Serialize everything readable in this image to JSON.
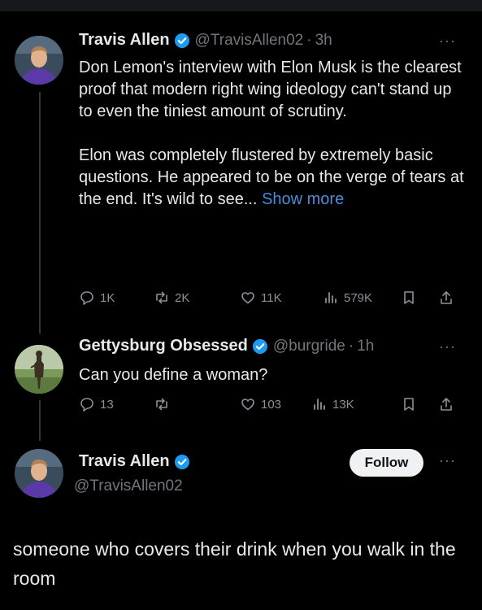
{
  "tweets": [
    {
      "name": "Travis Allen",
      "handle": "@TravisAllen02",
      "sep": "·",
      "time": "3h",
      "more": "···",
      "paragraphs": [
        "Don Lemon's interview with Elon Musk is the clearest proof that modern right wing ideology can't stand up to even the tiniest amount of scrutiny.",
        "Elon was completely flustered by extremely basic questions. He appeared to be on the verge of tears at the end. It's wild to see..."
      ],
      "show_more": "Show more",
      "actions": {
        "replies": "1K",
        "reposts": "2K",
        "likes": "11K",
        "views": "579K"
      }
    },
    {
      "name": "Gettysburg Obsessed",
      "handle": "@burgride",
      "sep": "·",
      "time": "1h",
      "more": "···",
      "text": "Can you define a woman?",
      "actions": {
        "replies": "13",
        "reposts": "",
        "likes": "103",
        "views": "13K"
      }
    }
  ],
  "reply": {
    "name": "Travis Allen",
    "handle": "@TravisAllen02",
    "follow_label": "Follow",
    "more": "···",
    "text": "someone who covers their drink when you walk in the room"
  },
  "icons": {
    "reply": "comment-icon",
    "repost": "repost-icon",
    "like": "heart-icon",
    "views": "views-icon",
    "bookmark": "bookmark-icon",
    "share": "share-icon",
    "verified": "verified-badge-icon"
  },
  "colors": {
    "background": "#000000",
    "link": "#4f8ad6",
    "verified": "#1d9bf0",
    "muted": "#71767b"
  }
}
